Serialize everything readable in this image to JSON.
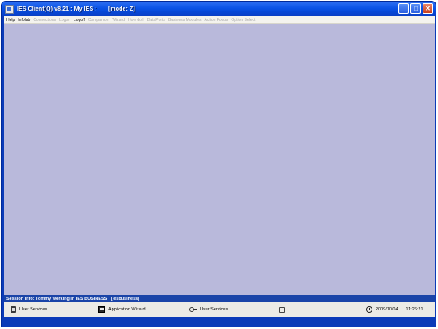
{
  "window": {
    "title": "IES Client(Q) v8.21 : My IES :       [mode: Z]",
    "minimize_icon": "minimize-icon",
    "maximize_icon": "maximize-icon",
    "close_icon": "close-icon"
  },
  "menu": {
    "items": [
      {
        "label": "Help",
        "enabled": true
      },
      {
        "label": "Infolab",
        "enabled": true
      },
      {
        "label": "Connections",
        "enabled": false
      },
      {
        "label": "Logon",
        "enabled": false
      },
      {
        "label": "Logoff",
        "enabled": true
      },
      {
        "label": "Companion",
        "enabled": false
      },
      {
        "label": "Wizard",
        "enabled": false
      },
      {
        "label": "How do I",
        "enabled": false
      },
      {
        "label": "DataPorts",
        "enabled": false
      },
      {
        "label": "Business Modules",
        "enabled": false
      },
      {
        "label": "Action Focus",
        "enabled": false
      },
      {
        "label": "Option Select",
        "enabled": false
      }
    ]
  },
  "client_area": {
    "background": "#b9b9db"
  },
  "session": {
    "text": "Session Info: Tommy working in IES BUSINESS   [iesbusiness]"
  },
  "status": {
    "panel1": {
      "label": "User Services",
      "icon": "user-services-icon"
    },
    "panel2": {
      "label": "Application Wizard",
      "icon": "wizard-icon"
    },
    "panel3": {
      "label": "User Services",
      "icon": "key-icon"
    },
    "panel4": {
      "label": "",
      "icon": "misc-icon"
    },
    "date": "2009/10/04",
    "time": "11:26:21"
  },
  "colors": {
    "titlebar": "#0b53e6",
    "frame": "#0b3bb8",
    "session_bar": "#1a44a8",
    "statusbar": "#ecebe6"
  }
}
